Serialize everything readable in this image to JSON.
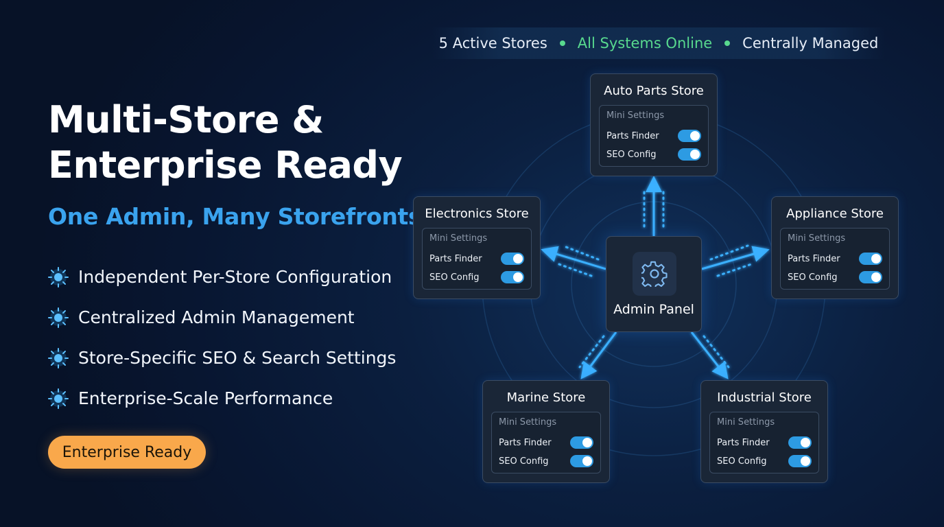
{
  "hero": {
    "title": "Multi-Store & Enterprise Ready",
    "subtitle": "One Admin, Many Storefronts",
    "features": [
      "Independent Per-Store Configuration",
      "Centralized Admin Management",
      "Store-Specific SEO & Search Settings",
      "Enterprise-Scale Performance"
    ],
    "cta_label": "Enterprise Ready"
  },
  "status_bar": {
    "items": [
      "5 Active Stores",
      "All Systems Online",
      "Centrally Managed"
    ],
    "online_color": "#58d98e"
  },
  "hub": {
    "label": "Admin Panel",
    "icon": "gear-icon"
  },
  "stores": [
    {
      "name": "Auto Parts Store",
      "settings_heading": "Mini Settings",
      "settings": [
        {
          "label": "Parts Finder",
          "enabled": true
        },
        {
          "label": "SEO Config",
          "enabled": true
        }
      ]
    },
    {
      "name": "Electronics Store",
      "settings_heading": "Mini Settings",
      "settings": [
        {
          "label": "Parts Finder",
          "enabled": true
        },
        {
          "label": "SEO Config",
          "enabled": true
        }
      ]
    },
    {
      "name": "Appliance Store",
      "settings_heading": "Mini Settings",
      "settings": [
        {
          "label": "Parts Finder",
          "enabled": true
        },
        {
          "label": "SEO Config",
          "enabled": true
        }
      ]
    },
    {
      "name": "Marine Store",
      "settings_heading": "Mini Settings",
      "settings": [
        {
          "label": "Parts Finder",
          "enabled": true
        },
        {
          "label": "SEO Config",
          "enabled": true
        }
      ]
    },
    {
      "name": "Industrial Store",
      "settings_heading": "Mini Settings",
      "settings": [
        {
          "label": "Parts Finder",
          "enabled": true
        },
        {
          "label": "SEO Config",
          "enabled": true
        }
      ]
    }
  ],
  "colors": {
    "accent": "#3aa3ee",
    "cta": "#f9a84b",
    "toggle_on": "#2d9be3",
    "connector": "#3ab0ff"
  }
}
